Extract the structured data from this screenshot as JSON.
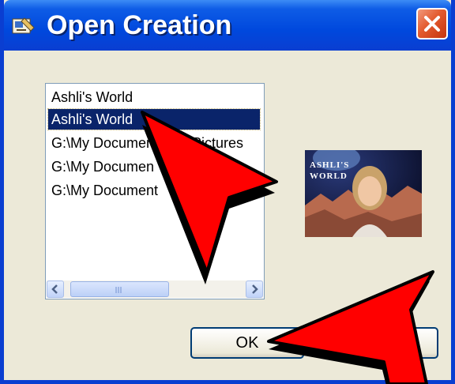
{
  "window": {
    "title": "Open Creation",
    "title_icon": "app-icon",
    "close_icon": "close-icon"
  },
  "list": {
    "items": [
      {
        "label": "Ashli's World",
        "selected": false
      },
      {
        "label": "Ashli's World",
        "selected": true
      },
      {
        "label": "G:\\My Documents\\My Pictures",
        "selected": false
      },
      {
        "label": "G:\\My Documen",
        "selected": false
      },
      {
        "label": "G:\\My Document",
        "selected": false
      }
    ]
  },
  "thumbnail": {
    "caption_line1": "ASHLI'S",
    "caption_line2": "WORLD"
  },
  "buttons": {
    "ok_label": "OK"
  },
  "annotations": {
    "arrow_color": "#ff0000"
  }
}
